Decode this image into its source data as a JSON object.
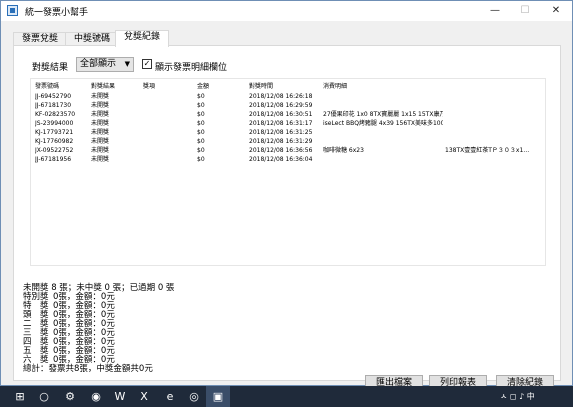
{
  "window": {
    "title": "統一發票小幫手"
  },
  "titlebar_buttons": {
    "minimize": "—",
    "maximize": "☐",
    "close": "✕"
  },
  "tabs": [
    {
      "label": "發票兌獎"
    },
    {
      "label": "中獎號碼"
    },
    {
      "label": "兌獎紀錄"
    }
  ],
  "filter": {
    "label": "對獎結果",
    "selected": "全部顯示",
    "checkbox_checked": true,
    "checkbox_label": "顯示發票明細欄位"
  },
  "grid": {
    "headers": [
      "發票號碼",
      "對獎結果",
      "獎項",
      "金額",
      "對獎時間",
      "消費明細",
      ""
    ],
    "rows": [
      [
        "JJ-69452790",
        "未開獎",
        "",
        "$0",
        "2018/12/08 16:26:18",
        "",
        ""
      ],
      [
        "JJ-67181730",
        "未開獎",
        "",
        "$0",
        "2018/12/08 16:29:59",
        "",
        ""
      ],
      [
        "KF-02823570",
        "未開獎",
        "",
        "$0",
        "2018/12/08 16:30:51",
        "27優果印花 1x0 8TX寶麗麗 1x15 15TX康乃馨營養素 2x39 78TX生鮮…",
        ""
      ],
      [
        "JS-23994000",
        "未開獎",
        "",
        "$0",
        "2018/12/08 16:31:17",
        "iseLect BBQ烤豬腿 4x39 156TX美味多100cc 1x8 8TX合計 2 項 總計 1…",
        ""
      ],
      [
        "KJ-17793721",
        "未開獎",
        "",
        "$0",
        "2018/12/08 16:31:25",
        "",
        ""
      ],
      [
        "KJ-17760982",
        "未開獎",
        "",
        "$0",
        "2018/12/08 16:31:29",
        "",
        ""
      ],
      [
        "JX-09522752",
        "未開獎",
        "",
        "$0",
        "2018/12/08 16:36:56",
        "咖啡微糖 6x23",
        "138TX壹壹紅茶TＰ３０３x1…"
      ],
      [
        "JJ-67181956",
        "未開獎",
        "",
        "$0",
        "2018/12/08 16:36:04",
        "",
        ""
      ]
    ]
  },
  "summary": {
    "line1": "未開獎 8 張；未中獎 0 張；已過期 0 張",
    "prizes": [
      {
        "label": "特別獎",
        "value": "0張，金額：0元"
      },
      {
        "label": "特　獎",
        "value": "0張，金額：0元"
      },
      {
        "label": "頭　獎",
        "value": "0張，金額：0元"
      },
      {
        "label": "二　獎",
        "value": "0張，金額：0元"
      },
      {
        "label": "三　獎",
        "value": "0張，金額：0元"
      },
      {
        "label": "四　獎",
        "value": "0張，金額：0元"
      },
      {
        "label": "五　獎",
        "value": "0張，金額：0元"
      },
      {
        "label": "六　獎",
        "value": "0張，金額：0元"
      }
    ],
    "total": "總計：發票共8張，中獎金額共0元"
  },
  "buttons": {
    "export": "匯出檔案",
    "print": "列印報表",
    "clear": "清除紀錄"
  },
  "taskbar": {
    "icons": [
      "windows-icon",
      "search-icon",
      "settings-icon",
      "line-icon",
      "word-icon",
      "excel-icon",
      "edge-icon",
      "chrome-icon",
      "app-icon"
    ],
    "glyphs": [
      "⊞",
      "○",
      "⚙",
      "◉",
      "W",
      "X",
      "e",
      "◎",
      "▣"
    ],
    "tray": "ㅅ ◻ ♪ 中"
  },
  "colors": {
    "taskbar": "#1f2a3a",
    "window_bg": "#f0f0f0",
    "accent": "#2a6fb8"
  }
}
